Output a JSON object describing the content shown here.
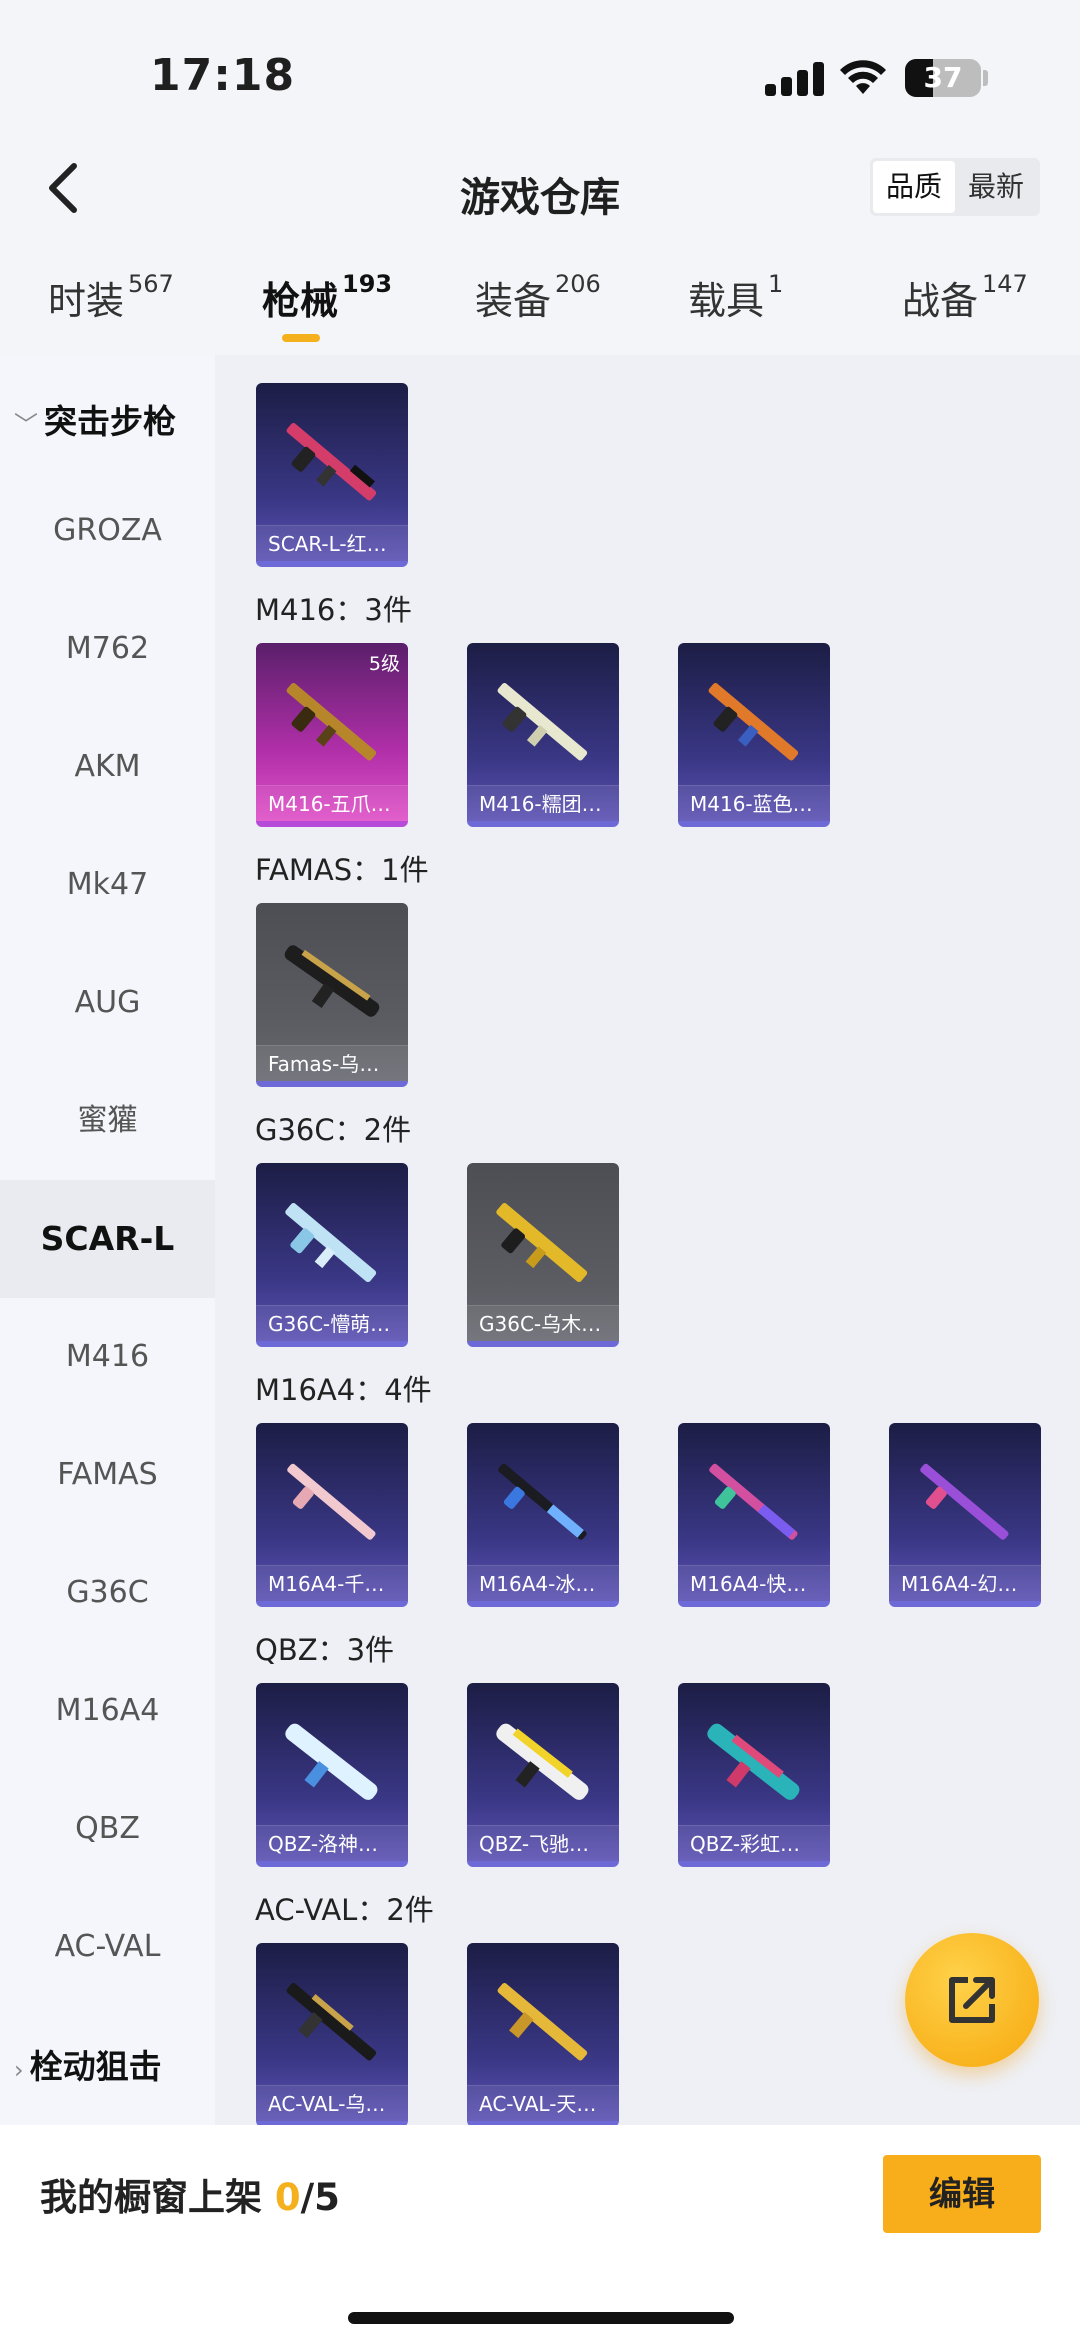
{
  "status": {
    "time": "17:18",
    "battery": "37",
    "battery_level": 0.37
  },
  "header": {
    "title": "游戏仓库",
    "sort_options": [
      "品质",
      "最新"
    ],
    "sort_selected": "品质"
  },
  "tabs": [
    {
      "label": "时装",
      "count": "567"
    },
    {
      "label": "枪械",
      "count": "193"
    },
    {
      "label": "装备",
      "count": "206"
    },
    {
      "label": "载具",
      "count": "1"
    },
    {
      "label": "战备",
      "count": "147"
    }
  ],
  "sidebar": {
    "group_open": "突击步枪",
    "items": [
      "GROZA",
      "M762",
      "AKM",
      "Mk47",
      "AUG",
      "蜜獾",
      "SCAR-L",
      "M416",
      "FAMAS",
      "G36C",
      "M16A4",
      "QBZ",
      "AC-VAL"
    ],
    "selected": "SCAR-L",
    "group_closed": "栓动狙击"
  },
  "groups": [
    {
      "label": "",
      "items": [
        {
          "name": "SCAR-L-红…"
        }
      ]
    },
    {
      "label": "M416：3件",
      "items": [
        {
          "name": "M416-五爪…",
          "level": "5级"
        },
        {
          "name": "M416-糯团…"
        },
        {
          "name": "M416-蓝色…"
        }
      ]
    },
    {
      "label": "FAMAS：1件",
      "items": [
        {
          "name": "Famas-乌木…"
        }
      ]
    },
    {
      "label": "G36C：2件",
      "items": [
        {
          "name": "G36C-懵萌…"
        },
        {
          "name": "G36C-乌木…"
        }
      ]
    },
    {
      "label": "M16A4：4件",
      "items": [
        {
          "name": "M16A4-千…"
        },
        {
          "name": "M16A4-冰…"
        },
        {
          "name": "M16A4-快…"
        },
        {
          "name": "M16A4-幻…"
        }
      ]
    },
    {
      "label": "QBZ：3件",
      "items": [
        {
          "name": "QBZ-洛神天依"
        },
        {
          "name": "QBZ-飞驰魅影"
        },
        {
          "name": "QBZ-彩虹符号"
        }
      ]
    },
    {
      "label": "AC-VAL：2件",
      "items": [
        {
          "name": "AC-VAL-乌…"
        },
        {
          "name": "AC-VAL-天…"
        }
      ]
    }
  ],
  "bottom": {
    "label": "我的橱窗上架",
    "current": "0",
    "total": "/5",
    "edit_label": "编辑"
  },
  "colors": {
    "accent": "#f5b01e",
    "card_purple": "#3a3785",
    "card_pink": "#b02fa8"
  }
}
